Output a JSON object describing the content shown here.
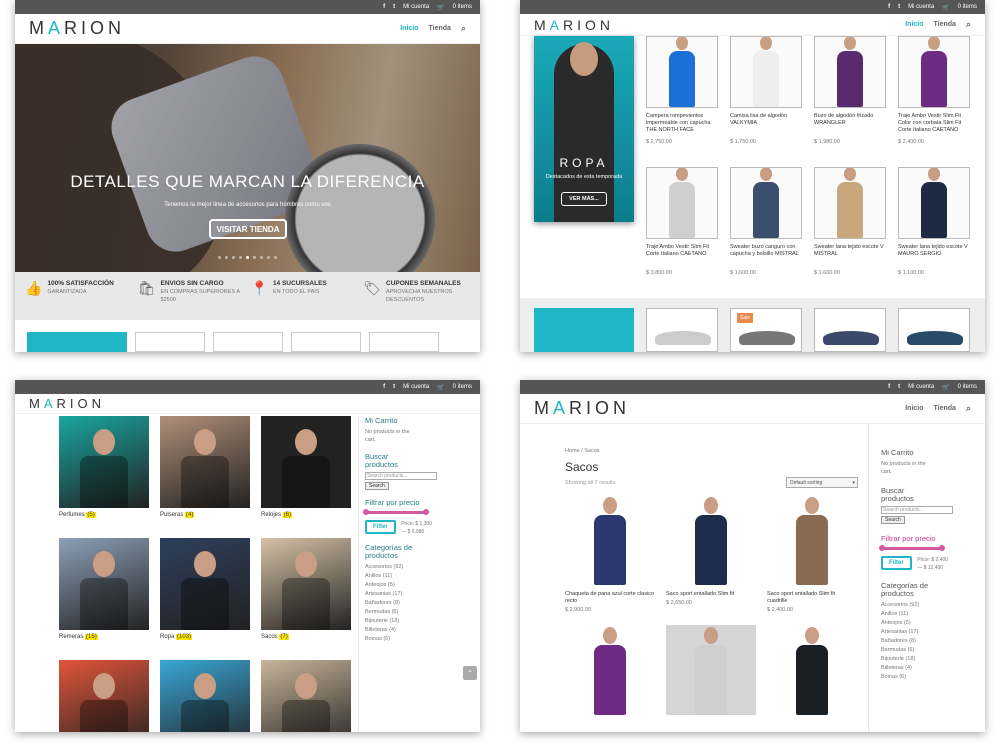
{
  "topbar": {
    "my_account": "Mi cuenta",
    "items": "0 items"
  },
  "brand": {
    "logo_pre": "M",
    "logo_a": "A",
    "logo_post": "RION"
  },
  "nav": {
    "home": "Inicio",
    "shop": "Tienda"
  },
  "hero": {
    "headline": "DETALLES QUE MARCAN LA DIFERENCIA",
    "subtitle": "Tenemos la mejor linea de accesorios para hombres como vos",
    "cta": "VISITAR TIENDA"
  },
  "features": [
    {
      "icon": "thumbs-up-icon",
      "title": "100% SATISFACCIÓN",
      "desc": "GARANTIZADA"
    },
    {
      "icon": "shopping-bag-icon",
      "title": "ENVIOS SIN CARGO",
      "desc": "EN COMPRAS SUPERIORES A $2500"
    },
    {
      "icon": "location-pin-icon",
      "title": "14 SUCURSALES",
      "desc": "EN TODO EL PAIS"
    },
    {
      "icon": "tag-icon",
      "title": "CUPONES SEMANALES",
      "desc": "APROVECHA NUESTROS DESCUENTOS"
    }
  ],
  "promo": {
    "title": "ROPA",
    "subtitle": "Destacados de esta temporada",
    "cta": "VER MÁS..."
  },
  "products": [
    {
      "name": "Campera rompevientos impermeable con capucha THE NORTH FACE",
      "price": "$ 2,750.00",
      "color": "#1d6fd8"
    },
    {
      "name": "Camisa lisa de algodón VALKYMIA",
      "price": "$ 1,750.00",
      "color": "#eeeeee"
    },
    {
      "name": "Buzo de algodón frizado WRANGLER",
      "price": "$ 1,980.00",
      "color": "#5a2a6e"
    },
    {
      "name": "Traje Ambo Vestir Slim Fit Color con corbata Slim Fit Corte Italiano CAETANO",
      "price": "$ 2,400.00",
      "color": "#6d2b86"
    },
    {
      "name": "Traje Ambo Vestir Slim Fit Corte Italiano CAETANO",
      "price": "$ 3,800.00",
      "color": "#cfcfcf"
    },
    {
      "name": "Sweater buzo canguro con capucha y bolsillo MISTRAL",
      "price": "$ 1,600.00",
      "color": "#3a4e6e"
    },
    {
      "name": "Sweater lana tejido escote V MISTRAL",
      "price": "$ 1,600.00",
      "color": "#c9a77c"
    },
    {
      "name": "Sweater lana tejido escote V MAURO SERGIO",
      "price": "$ 1,100.00",
      "color": "#1e2a44"
    }
  ],
  "sale_badge": "Sale",
  "categories": [
    {
      "name": "Perfumes",
      "count": "(5)",
      "color": "#1aa5a0"
    },
    {
      "name": "Pulseras",
      "count": "(4)",
      "color": "#b08f78"
    },
    {
      "name": "Relojes",
      "count": "(6)",
      "color": "#222222"
    },
    {
      "name": "Remeras",
      "count": "(15)",
      "color": "#8da0b8"
    },
    {
      "name": "Ropa",
      "count": "(103)",
      "color": "#2e3f5c"
    },
    {
      "name": "Sacos",
      "count": "(7)",
      "color": "#d6c2a6"
    },
    {
      "name": "",
      "count": "",
      "color": "#e0553a"
    },
    {
      "name": "",
      "count": "",
      "color": "#39a6d6"
    },
    {
      "name": "",
      "count": "",
      "color": "#c8b49a"
    }
  ],
  "cart": {
    "title": "Mi Carrito",
    "empty": "No products in the cart."
  },
  "search": {
    "title": "Buscar productos",
    "placeholder": "Search products...",
    "button": "Search"
  },
  "price_filter": {
    "title": "Filtrar por precio",
    "button": "Filter",
    "price_label": "Price:",
    "p3_min": "$ 1,300",
    "p3_max": "$ 6,980",
    "p4_min": "$ 2,400",
    "p4_max": "$ 12,400",
    "sep": "—"
  },
  "cat_widget": {
    "title": "Categorías de productos",
    "items": [
      "Accesorios (92)",
      "Anillos (11)",
      "Anteojos (5)",
      "Artesanias (17)",
      "Bañadores (8)",
      "Bermudas (6)",
      "Bijouterie (18)",
      "Billeteras (4)",
      "Boinas (6)"
    ]
  },
  "sacos_page": {
    "breadcrumb": "Home / Sacos",
    "title": "Sacos",
    "showing": "Showing all 7 results",
    "sort": "Default sorting",
    "items": [
      {
        "name": "Chaqueta de pana azul corte clasico recto",
        "price": "$ 2,900.00",
        "color": "#2a3a6e"
      },
      {
        "name": "Saco sport entallado Slim fit",
        "price": "$ 2,650.00",
        "color": "#1f2d4d"
      },
      {
        "name": "Saco sport entallado Slim fit cuadrille",
        "price": "$ 2,400.00",
        "color": "#8a6a50"
      },
      {
        "name": "",
        "price": "",
        "color": "#6d2b86"
      },
      {
        "name": "",
        "price": "",
        "color": "#cfcfcf"
      },
      {
        "name": "",
        "price": "",
        "color": "#1a1f26"
      }
    ]
  },
  "colors": {
    "accent": "#1fb6c6",
    "filter": "#d35aa0",
    "topbar": "#555555"
  }
}
